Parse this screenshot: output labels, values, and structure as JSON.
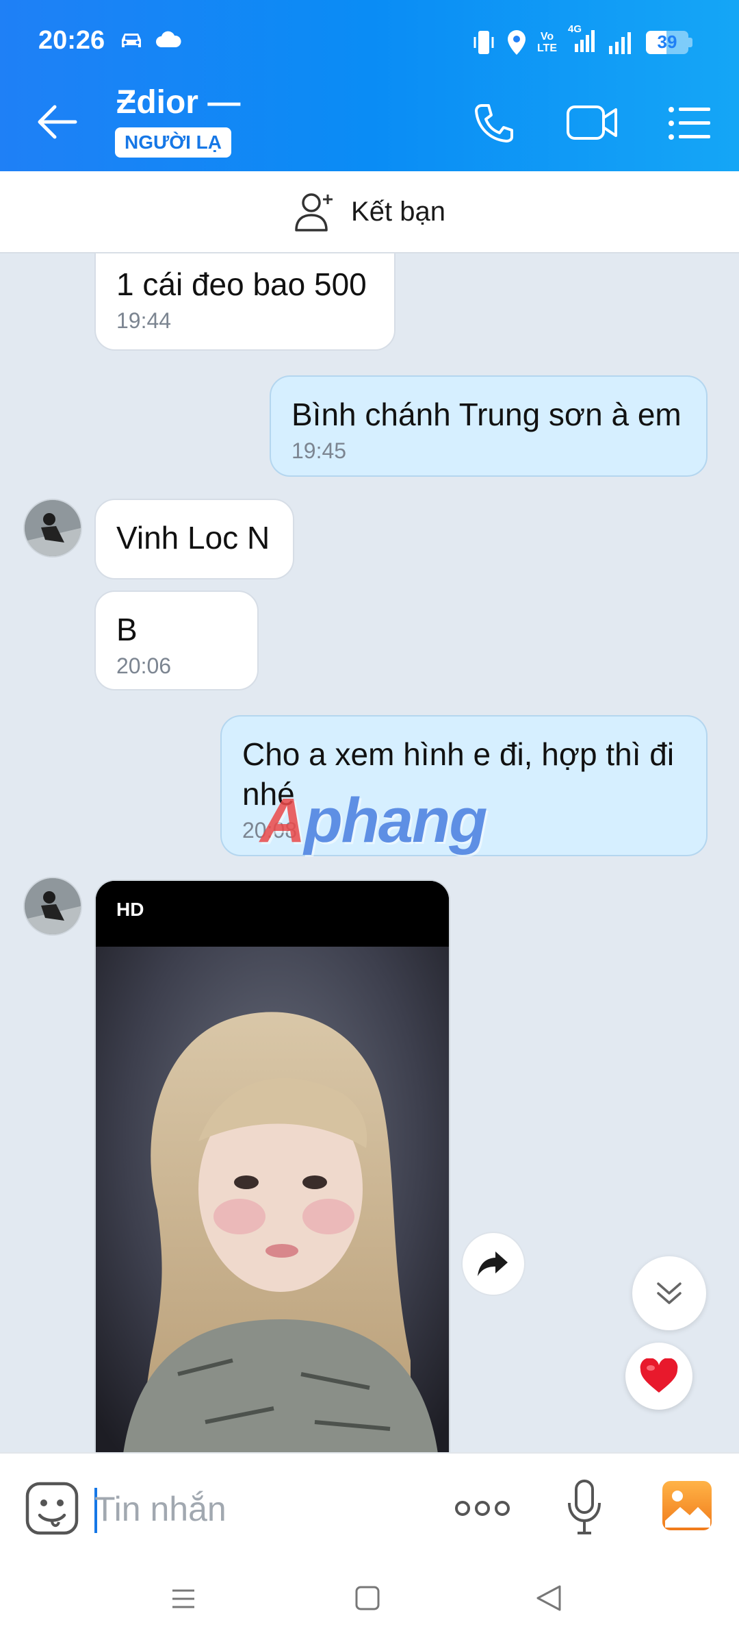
{
  "status_bar": {
    "time": "20:26",
    "network_top": "Vo",
    "network_bottom": "LTE",
    "data_type": "4G",
    "battery": "39",
    "icons": [
      "car-icon",
      "cloud-icon",
      "vibrate-icon",
      "location-icon",
      "volte-icon",
      "signal-icon",
      "battery-icon"
    ]
  },
  "header": {
    "contact_name": "Ƶdior —",
    "badge": "NGƯỜI LẠ",
    "icons": [
      "back-arrow-icon",
      "phone-icon",
      "video-camera-icon",
      "menu-list-icon"
    ],
    "color_left": "#1f80f6",
    "color_right": "#15a6f6"
  },
  "add_friend": {
    "label": "Kết bạn"
  },
  "messages": [
    {
      "side": "in",
      "text": "1 cái đeo bao 500",
      "time": "19:44"
    },
    {
      "side": "out",
      "text": "Bình chánh Trung sơn à em",
      "time": "19:45"
    },
    {
      "side": "in",
      "text": "Vinh Loc N",
      "time": ""
    },
    {
      "side": "in",
      "text": "B",
      "time": "20:06"
    },
    {
      "side": "out",
      "text": "Cho a xem hình e đi, hợp thì đi nhé",
      "time": "20:08"
    }
  ],
  "photo_message": {
    "badge": "HD"
  },
  "watermark": {
    "first_letter": "A",
    "rest": "phang"
  },
  "composer": {
    "placeholder": "Tin nhắn",
    "value": ""
  },
  "colors": {
    "chat_background": "#e2e9f1",
    "outgoing_bubble": "#d6efff",
    "incoming_bubble": "#ffffff",
    "accent": "#1677e6",
    "heart": "#e8192c"
  }
}
